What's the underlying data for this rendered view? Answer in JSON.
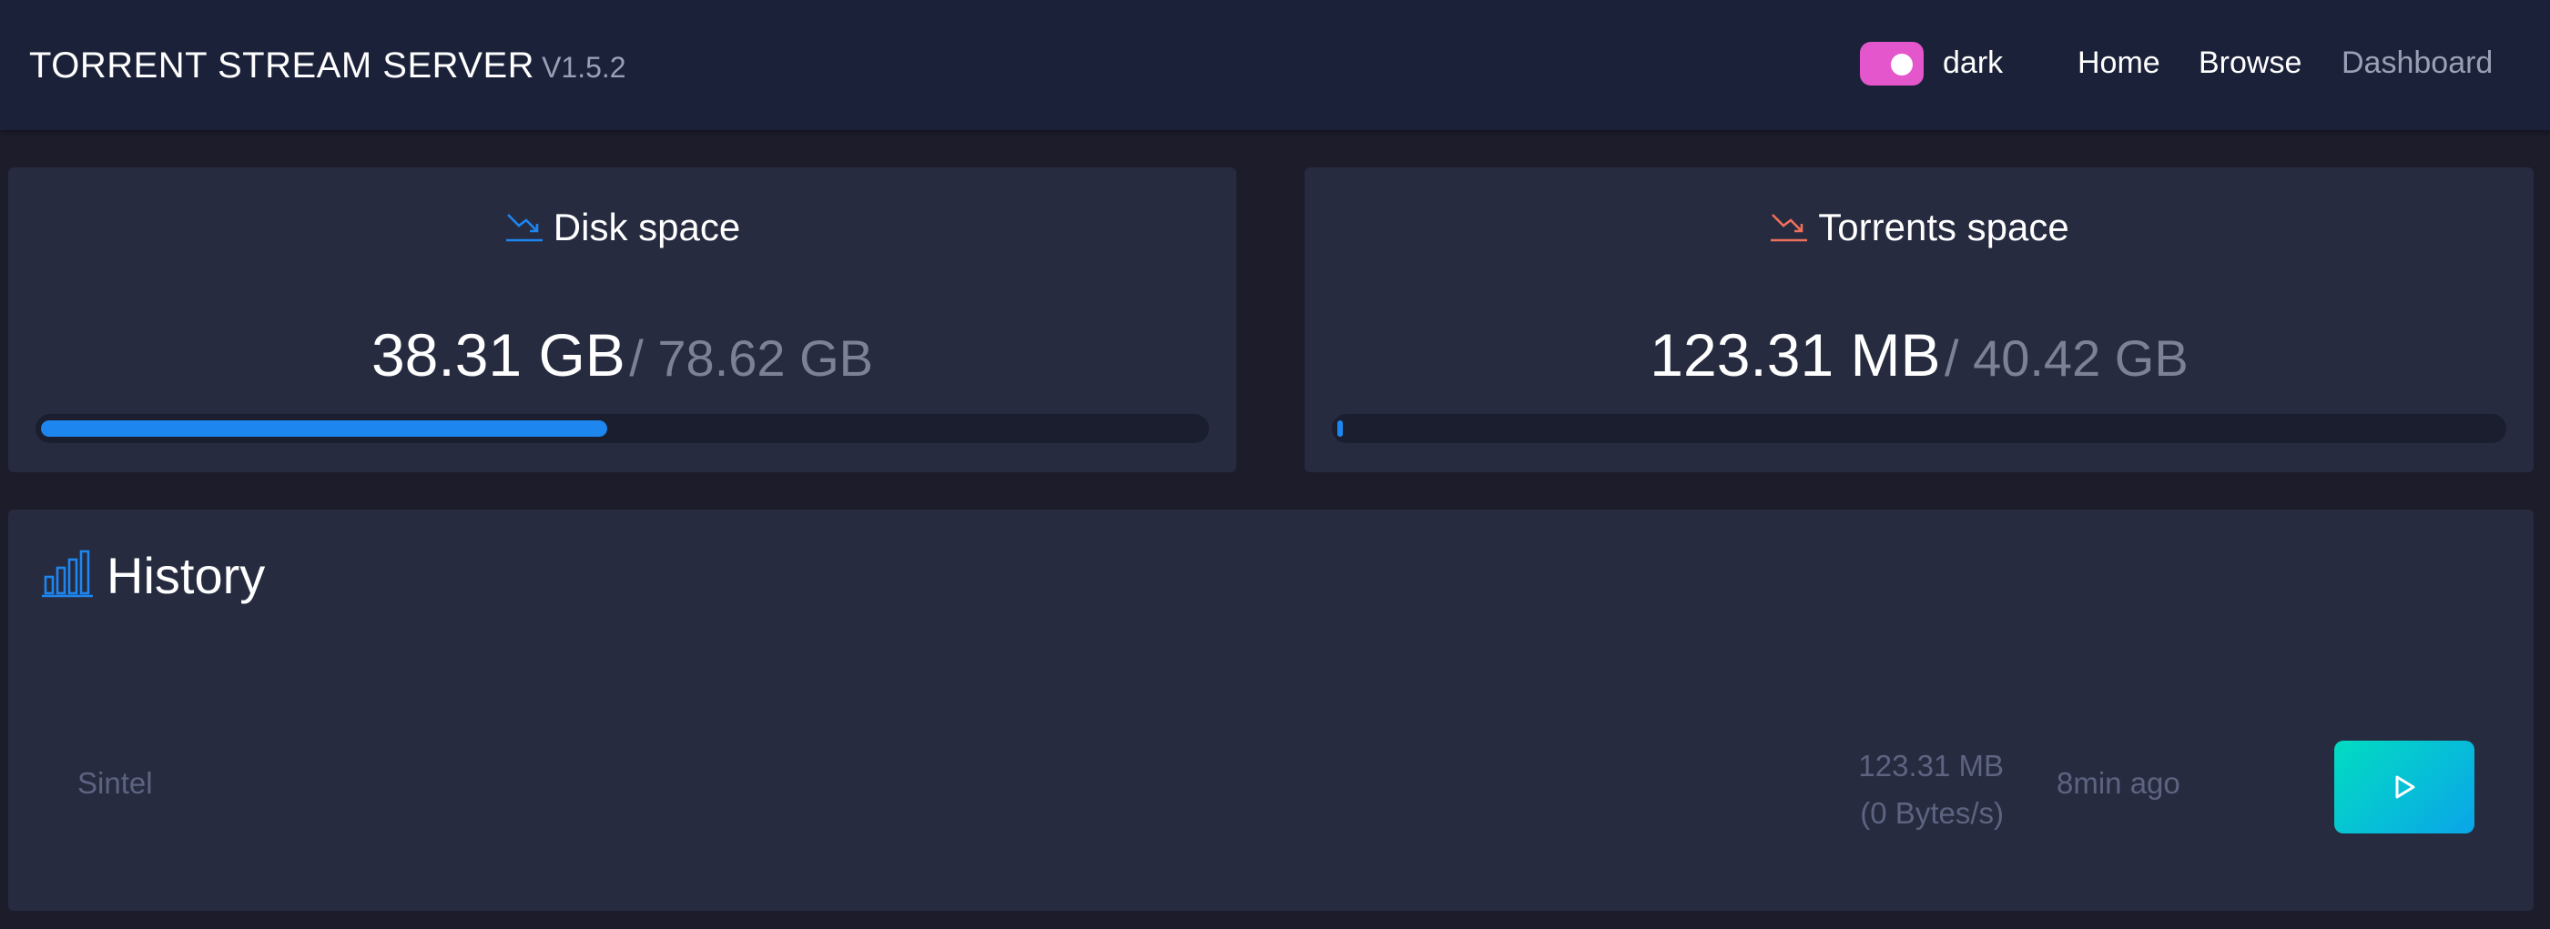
{
  "header": {
    "brand": "TORRENT STREAM SERVER",
    "version": "V1.5.2",
    "theme_label": "dark",
    "nav": {
      "home": "Home",
      "browse": "Browse",
      "dashboard": "Dashboard"
    }
  },
  "disk": {
    "title": "Disk space",
    "used": "38.31 GB",
    "total": "/ 78.62 GB",
    "fill_fraction": 0.487,
    "color": "#1e86ef"
  },
  "torrents": {
    "title": "Torrents space",
    "used": "123.31 MB",
    "total": "/ 40.42 GB",
    "fill_fraction": 0.003,
    "color": "#ef6f5a"
  },
  "history": {
    "title": "History",
    "items": [
      {
        "name": "Sintel",
        "size": "123.31 MB",
        "speed": "(0 Bytes/s)",
        "time": "8min ago"
      }
    ]
  },
  "colors": {
    "accent": "#1e86ef",
    "toggle": "#e456cc",
    "play_gradient_start": "#02dcc2",
    "play_gradient_end": "#0aa5e8"
  }
}
